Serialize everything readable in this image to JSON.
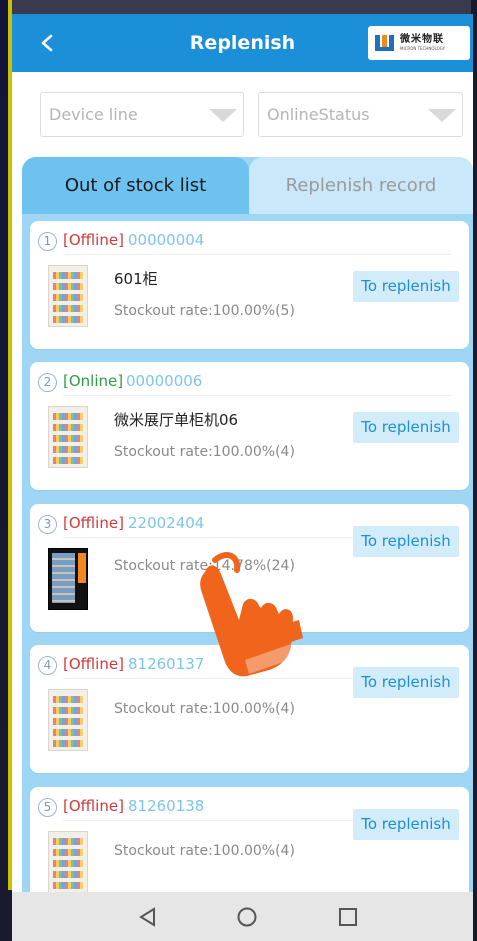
{
  "header": {
    "title": "Replenish",
    "logo_cn": "微米物联",
    "logo_en": "MICRON TECHNOLOGY"
  },
  "filters": {
    "device_line_placeholder": "Device line",
    "online_status_placeholder": "OnlineStatus"
  },
  "tabs": [
    {
      "label": "Out of stock list",
      "active": true
    },
    {
      "label": "Replenish record",
      "active": false
    }
  ],
  "action_label": "To replenish",
  "devices": [
    {
      "index": "1",
      "status": "[Offline]",
      "online": false,
      "id": "00000004",
      "name": "601柜",
      "rate": "Stockout rate:100.00%(5)",
      "thumb": "white-cabinet"
    },
    {
      "index": "2",
      "status": "[Online]",
      "online": true,
      "id": "00000006",
      "name": "微米展厅单柜机06",
      "rate": "Stockout rate:100.00%(4)",
      "thumb": "white-cabinet"
    },
    {
      "index": "3",
      "status": "[Offline]",
      "online": false,
      "id": "22002404",
      "name": "",
      "rate": "Stockout rate:14.78%(24)",
      "thumb": "black-cabinet"
    },
    {
      "index": "4",
      "status": "[Offline]",
      "online": false,
      "id": "81260137",
      "name": "",
      "rate": "Stockout rate:100.00%(4)",
      "thumb": "white-cabinet"
    },
    {
      "index": "5",
      "status": "[Offline]",
      "online": false,
      "id": "81260138",
      "name": "",
      "rate": "Stockout rate:100.00%(4)",
      "thumb": "white-cabinet"
    }
  ],
  "icons": {
    "back": "chevron-left-icon",
    "nav_back": "triangle-back-icon",
    "nav_home": "circle-home-icon",
    "nav_recent": "square-recent-icon",
    "pointer": "hand-pointer-icon"
  },
  "colors": {
    "header": "#1c8fd9",
    "tab_active": "#6ec2f0",
    "offline": "#d03a3a",
    "online": "#2f9c46",
    "device_id": "#7ec4ea",
    "button_bg": "#d2ecfa",
    "button_text": "#1e8fd6"
  }
}
